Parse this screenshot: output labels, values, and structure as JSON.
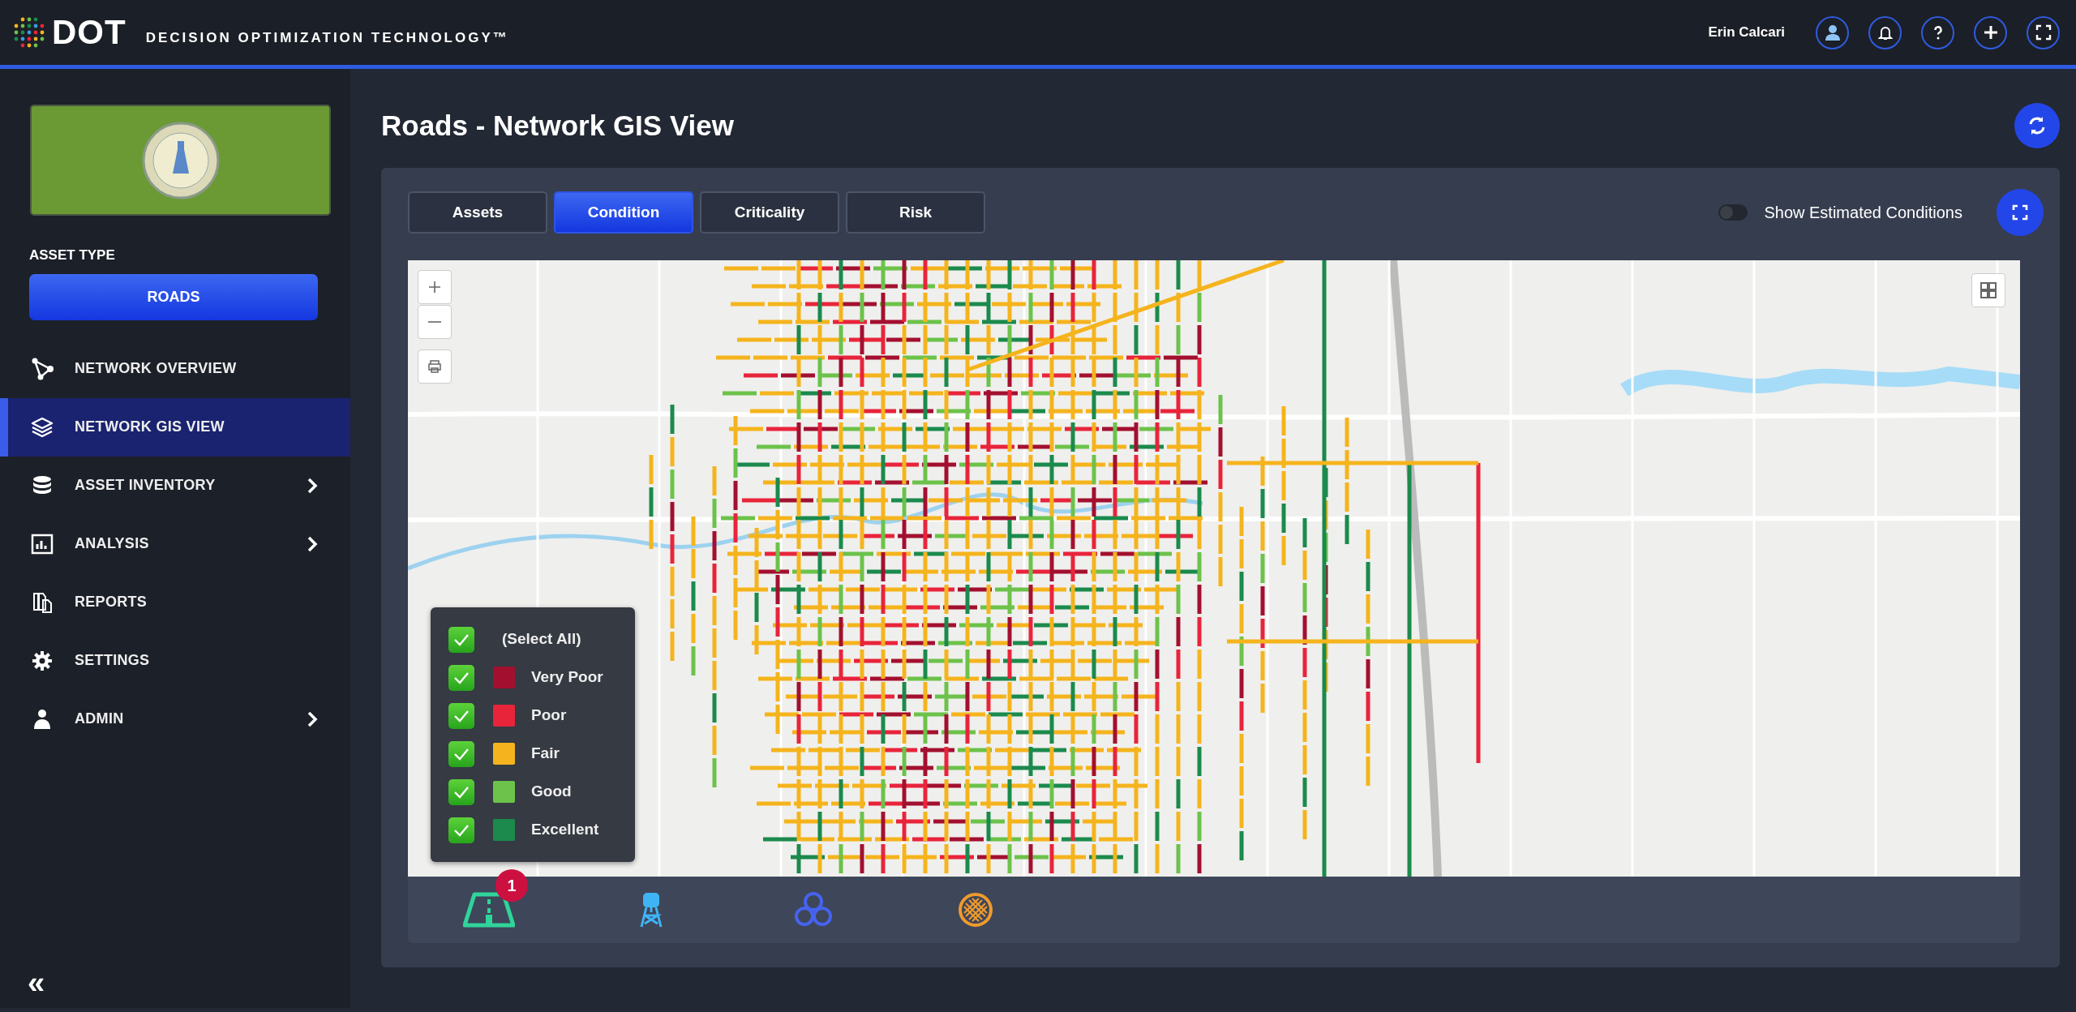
{
  "header": {
    "logo_text": "DOT",
    "tagline": "DECISION OPTIMIZATION TECHNOLOGY™",
    "user_name": "Erin Calcari"
  },
  "sidebar": {
    "asset_type_label": "ASSET TYPE",
    "asset_type": "ROADS",
    "items": [
      {
        "label": "NETWORK OVERVIEW",
        "selected": false,
        "has_submenu": false
      },
      {
        "label": "NETWORK GIS VIEW",
        "selected": true,
        "has_submenu": false
      },
      {
        "label": "ASSET INVENTORY",
        "selected": false,
        "has_submenu": true
      },
      {
        "label": "ANALYSIS",
        "selected": false,
        "has_submenu": true
      },
      {
        "label": "REPORTS",
        "selected": false,
        "has_submenu": false
      },
      {
        "label": "SETTINGS",
        "selected": false,
        "has_submenu": false
      },
      {
        "label": "ADMIN",
        "selected": false,
        "has_submenu": true
      }
    ],
    "collapse": "«"
  },
  "page": {
    "title": "Roads - Network GIS View"
  },
  "tabs": [
    {
      "label": "Assets",
      "selected": false
    },
    {
      "label": "Condition",
      "selected": true
    },
    {
      "label": "Criticality",
      "selected": false
    },
    {
      "label": "Risk",
      "selected": false
    }
  ],
  "estimated_toggle": {
    "label": "Show Estimated Conditions",
    "on": false
  },
  "legend": {
    "select_all": {
      "label": "(Select All)",
      "checked": true
    },
    "items": [
      {
        "label": "Very Poor",
        "checked": true,
        "color": "#a3102f"
      },
      {
        "label": "Poor",
        "checked": true,
        "color": "#e8243b"
      },
      {
        "label": "Fair",
        "checked": true,
        "color": "#f5b41d"
      },
      {
        "label": "Good",
        "checked": true,
        "color": "#6cc24a"
      },
      {
        "label": "Excellent",
        "checked": true,
        "color": "#1b8a4c"
      }
    ]
  },
  "layer_bar": {
    "badge": "1"
  }
}
